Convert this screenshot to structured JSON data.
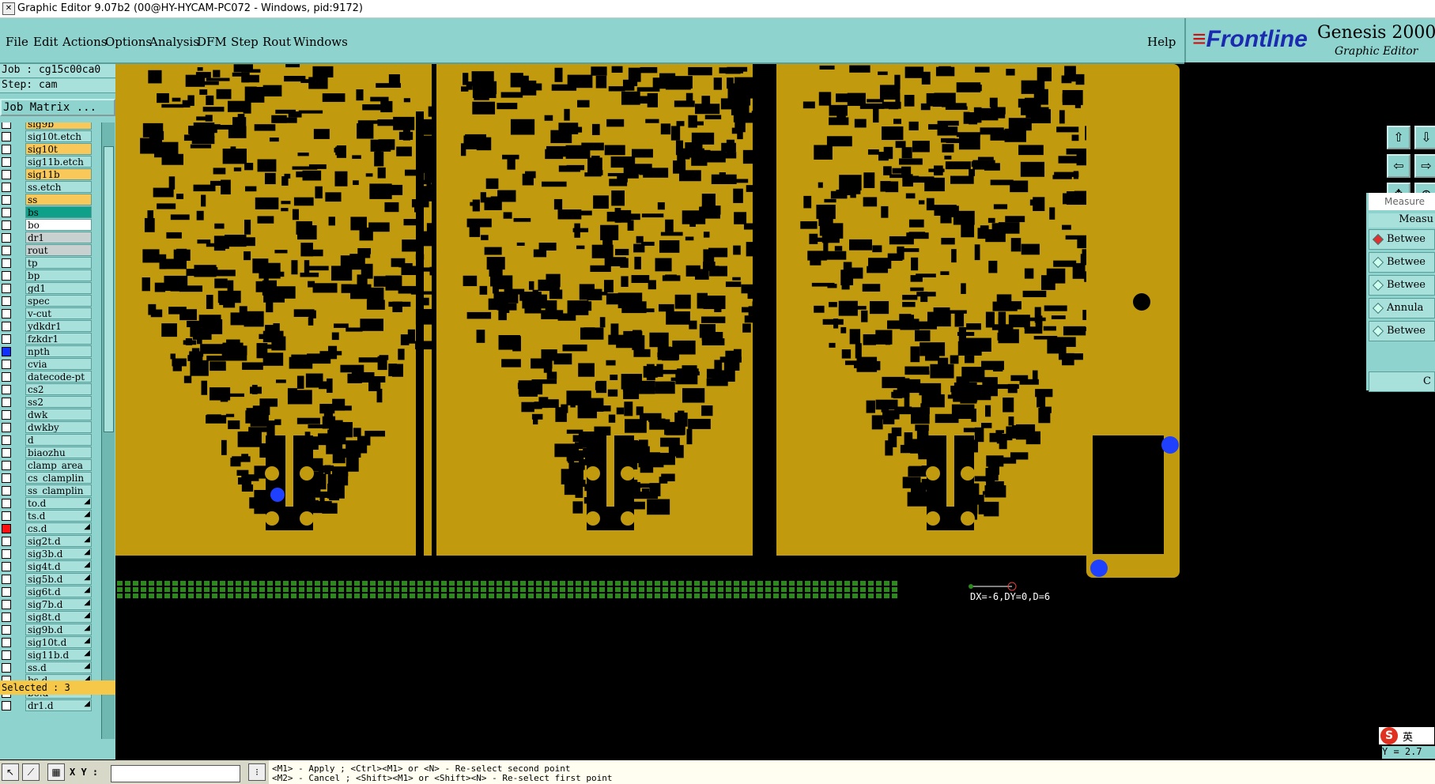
{
  "window": {
    "title": "Graphic Editor 9.07b2 (00@HY-HYCAM-PC072 - Windows, pid:9172)",
    "icon": "app-icon"
  },
  "menu": {
    "items": [
      "File",
      "Edit",
      "Actions",
      "Options",
      "Analysis",
      "DFM",
      "Step",
      "Rout",
      "Windows"
    ],
    "help": "Help"
  },
  "brand": {
    "logo_text": "Frontline",
    "product": "Genesis 2000",
    "subtitle": "Graphic Editor"
  },
  "job": {
    "job_line": "Job : cg15c00ca0",
    "step_line": "Step: cam",
    "matrix_button": "Job Matrix ..."
  },
  "layers": [
    {
      "name": "sig9b",
      "style": "y",
      "check": "",
      "arrow": ""
    },
    {
      "name": "sig10t.etch",
      "style": "",
      "check": "",
      "arrow": ""
    },
    {
      "name": "sig10t",
      "style": "y",
      "check": "",
      "arrow": ""
    },
    {
      "name": "sig11b.etch",
      "style": "",
      "check": "",
      "arrow": ""
    },
    {
      "name": "sig11b",
      "style": "y",
      "check": "",
      "arrow": ""
    },
    {
      "name": "ss.etch",
      "style": "",
      "check": "",
      "arrow": ""
    },
    {
      "name": "ss",
      "style": "y",
      "check": "",
      "arrow": ""
    },
    {
      "name": "bs",
      "style": "g",
      "check": "",
      "arrow": ""
    },
    {
      "name": "bo",
      "style": "w",
      "check": "",
      "arrow": ""
    },
    {
      "name": "dr1",
      "style": "gr",
      "check": "",
      "arrow": ""
    },
    {
      "name": "rout",
      "style": "gr",
      "check": "",
      "arrow": ""
    },
    {
      "name": "tp",
      "style": "",
      "check": "",
      "arrow": ""
    },
    {
      "name": "bp",
      "style": "",
      "check": "",
      "arrow": ""
    },
    {
      "name": "gd1",
      "style": "",
      "check": "",
      "arrow": ""
    },
    {
      "name": "spec",
      "style": "",
      "check": "",
      "arrow": ""
    },
    {
      "name": "v-cut",
      "style": "",
      "check": "",
      "arrow": ""
    },
    {
      "name": "ydkdr1",
      "style": "",
      "check": "",
      "arrow": ""
    },
    {
      "name": "fzkdr1",
      "style": "",
      "check": "",
      "arrow": ""
    },
    {
      "name": "npth",
      "style": "",
      "check": "blue",
      "arrow": ""
    },
    {
      "name": "cvia",
      "style": "",
      "check": "",
      "arrow": ""
    },
    {
      "name": "datecode-pt",
      "style": "",
      "check": "",
      "arrow": ""
    },
    {
      "name": "cs2",
      "style": "",
      "check": "",
      "arrow": ""
    },
    {
      "name": "ss2",
      "style": "",
      "check": "",
      "arrow": ""
    },
    {
      "name": "dwk",
      "style": "",
      "check": "",
      "arrow": ""
    },
    {
      "name": "dwkby",
      "style": "",
      "check": "",
      "arrow": ""
    },
    {
      "name": "d",
      "style": "",
      "check": "",
      "arrow": ""
    },
    {
      "name": "biaozhu",
      "style": "",
      "check": "",
      "arrow": ""
    },
    {
      "name": "clamp_area",
      "style": "",
      "check": "",
      "arrow": ""
    },
    {
      "name": "cs_clamplin",
      "style": "",
      "check": "",
      "arrow": ""
    },
    {
      "name": "ss_clamplin",
      "style": "",
      "check": "",
      "arrow": ""
    },
    {
      "name": "to.d",
      "style": "",
      "check": "",
      "arrow": "◢"
    },
    {
      "name": "ts.d",
      "style": "",
      "check": "",
      "arrow": "◢"
    },
    {
      "name": "cs.d",
      "style": "",
      "check": "red",
      "arrow": "◢"
    },
    {
      "name": "sig2t.d",
      "style": "",
      "check": "",
      "arrow": "◢"
    },
    {
      "name": "sig3b.d",
      "style": "",
      "check": "",
      "arrow": "◢"
    },
    {
      "name": "sig4t.d",
      "style": "",
      "check": "",
      "arrow": "◢"
    },
    {
      "name": "sig5b.d",
      "style": "",
      "check": "",
      "arrow": "◢"
    },
    {
      "name": "sig6t.d",
      "style": "",
      "check": "",
      "arrow": "◢"
    },
    {
      "name": "sig7b.d",
      "style": "",
      "check": "",
      "arrow": "◢"
    },
    {
      "name": "sig8t.d",
      "style": "",
      "check": "",
      "arrow": "◢"
    },
    {
      "name": "sig9b.d",
      "style": "",
      "check": "",
      "arrow": "◢"
    },
    {
      "name": "sig10t.d",
      "style": "",
      "check": "",
      "arrow": "◢"
    },
    {
      "name": "sig11b.d",
      "style": "",
      "check": "",
      "arrow": "◢"
    },
    {
      "name": "ss.d",
      "style": "",
      "check": "",
      "arrow": "◢"
    },
    {
      "name": "bs.d",
      "style": "",
      "check": "",
      "arrow": "◢"
    },
    {
      "name": "bo.d",
      "style": "",
      "check": "",
      "arrow": "◢"
    },
    {
      "name": "dr1.d",
      "style": "",
      "check": "",
      "arrow": "◢"
    }
  ],
  "selected": "Selected : 3",
  "measure": {
    "title": "Measure",
    "header": "Measu",
    "options": [
      {
        "label": "Betwee",
        "active": true
      },
      {
        "label": "Betwee",
        "active": false
      },
      {
        "label": "Betwee",
        "active": false
      },
      {
        "label": "Annula",
        "active": false
      },
      {
        "label": "Betwee",
        "active": false
      }
    ],
    "close_label": "C"
  },
  "canvas": {
    "measure_readout": "DX=-6,DY=0,D=6",
    "copper_color": "#c19a0e",
    "bg_color": "#000000",
    "pad_color": "#2a8a1a",
    "marker_color": "#2040ff"
  },
  "bottom": {
    "xy_label": "X Y :",
    "status_line1": "<M1> - Apply  ; <Ctrl><M1> or <N> - Re-select second point",
    "status_line2": "<M2> - Cancel ; <Shift><M1> or <Shift><N> - Re-select first point"
  },
  "right_status": {
    "ime": "英",
    "y_readout": "Y = 2.7"
  },
  "colors": {
    "panel_bg": "#8fd3cf",
    "highlight_yellow": "#f8c85a",
    "highlight_green": "#0fa08a"
  }
}
